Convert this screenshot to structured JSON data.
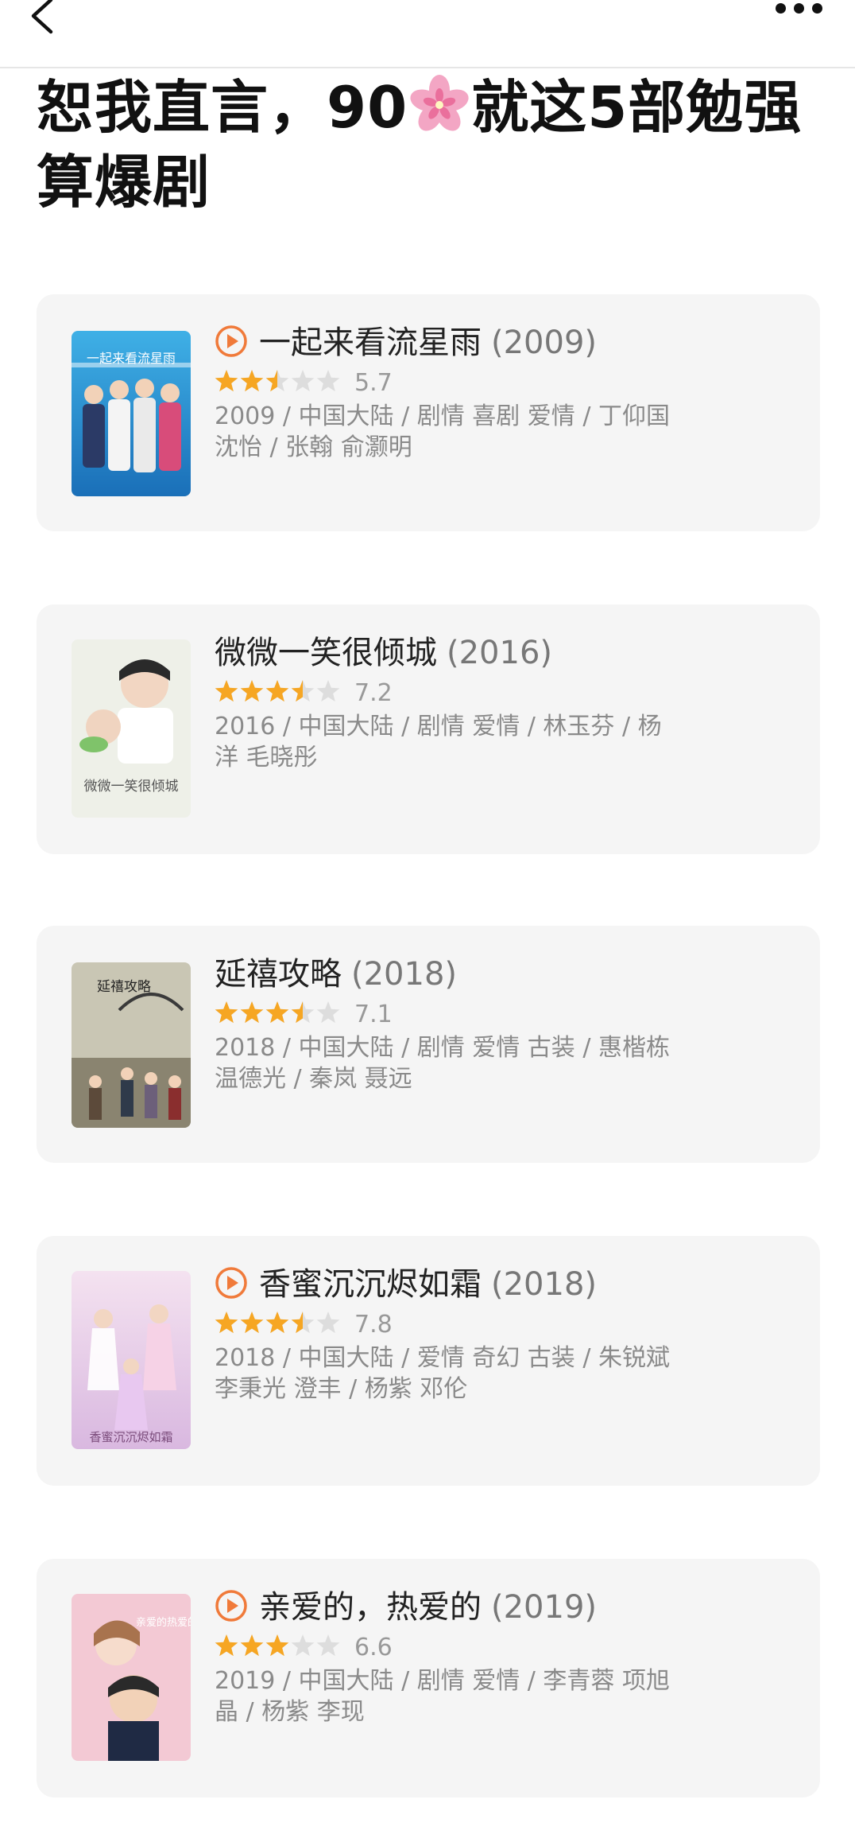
{
  "header": {
    "title": "恕我直言，90🌸就这5部勉强算爆剧",
    "title_part1": "恕我直言，90",
    "title_part2": "就这5部勉强算爆剧",
    "flower_icon": "cherry-blossom-icon"
  },
  "colors": {
    "accent_orange": "#f07a3a",
    "star": "#f6a623",
    "star_empty": "#dddddd",
    "card_bg": "#f5f5f5"
  },
  "movies": [
    {
      "title": "一起来看流星雨",
      "year": "(2009)",
      "rating": "5.7",
      "stars": 2.5,
      "has_play": true,
      "meta": "2009 / 中国大陆 / 剧情 喜剧 爱情 / 丁仰国 沈怡 / 张翰 俞灏明",
      "poster_text": "一起来看流星雨"
    },
    {
      "title": "微微一笑很倾城",
      "year": "(2016)",
      "rating": "7.2",
      "stars": 3.5,
      "has_play": false,
      "meta": "2016 / 中国大陆 / 剧情 爱情 / 林玉芬 / 杨洋 毛晓彤",
      "poster_text": "微微一笑很倾城"
    },
    {
      "title": "延禧攻略",
      "year": "(2018)",
      "rating": "7.1",
      "stars": 3.5,
      "has_play": false,
      "meta": "2018 / 中国大陆 / 剧情 爱情 古装 / 惠楷栋 温德光 / 秦岚 聂远",
      "poster_text": "延禧攻略"
    },
    {
      "title": "香蜜沉沉烬如霜",
      "year": "(2018)",
      "rating": "7.8",
      "stars": 3.5,
      "has_play": true,
      "meta": "2018 / 中国大陆 / 爱情 奇幻 古装 / 朱锐斌 李秉光 澄丰 / 杨紫 邓伦",
      "poster_text": "香蜜沉沉烬如霜"
    },
    {
      "title": "亲爱的，热爱的",
      "year": "(2019)",
      "rating": "6.6",
      "stars": 3,
      "has_play": true,
      "meta": "2019 / 中国大陆 / 剧情 爱情 / 李青蓉 项旭晶 / 杨紫 李现",
      "poster_text": "亲爱的热爱的"
    }
  ]
}
